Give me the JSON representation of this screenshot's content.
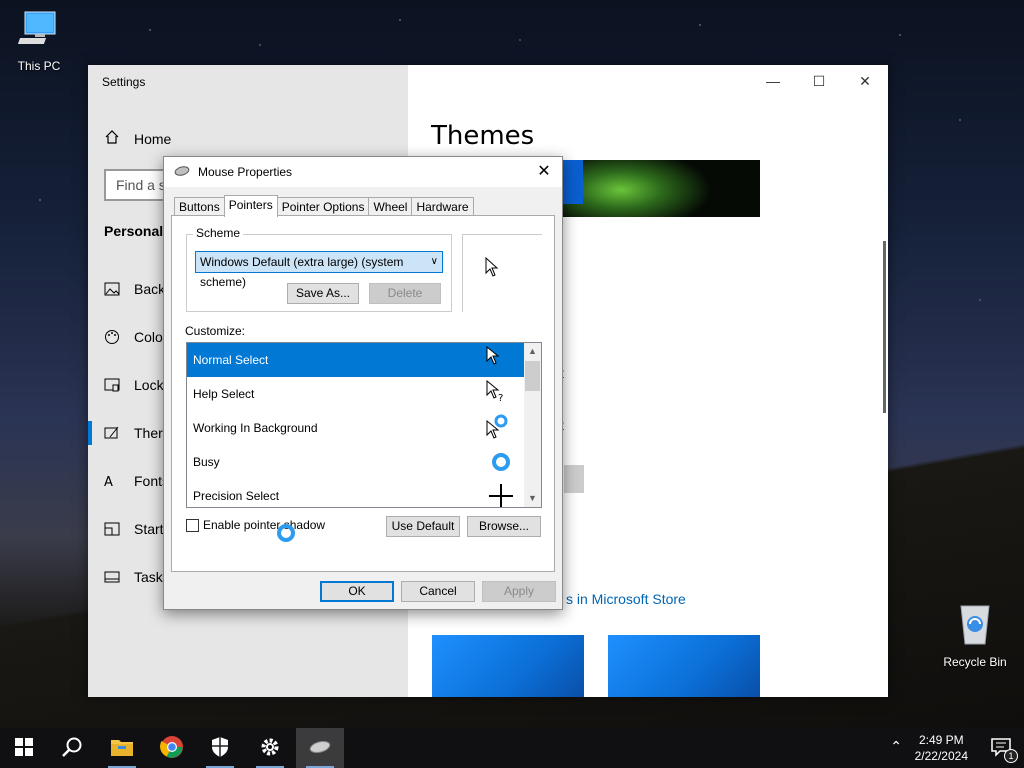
{
  "desktop": {
    "icons": [
      {
        "label": "This PC",
        "icon": "this-pc-icon"
      },
      {
        "label": "Recycle Bin",
        "icon": "recycle-bin-icon"
      }
    ]
  },
  "settings": {
    "window_title": "Settings",
    "sidebar": {
      "home_label": "Home",
      "find_placeholder": "Find a s",
      "section_title": "Personaliz",
      "items": [
        {
          "label": "Back",
          "icon": "picture-icon"
        },
        {
          "label": "Colo",
          "icon": "palette-icon"
        },
        {
          "label": "Lock",
          "icon": "lock-screen-icon"
        },
        {
          "label": "Ther",
          "icon": "themes-icon"
        },
        {
          "label": "Fonts",
          "icon": "fonts-icon"
        },
        {
          "label": "Start",
          "icon": "start-icon"
        },
        {
          "label": "Taskb",
          "icon": "taskbar-icon"
        }
      ]
    },
    "main": {
      "title": "Themes",
      "fragments": [
        "t",
        "t"
      ],
      "store_link": "s in Microsoft Store"
    }
  },
  "dialog": {
    "title": "Mouse Properties",
    "tabs": [
      "Buttons",
      "Pointers",
      "Pointer Options",
      "Wheel",
      "Hardware"
    ],
    "active_tab": "Pointers",
    "scheme": {
      "group_label": "Scheme",
      "selected": "Windows Default (extra large) (system scheme)",
      "save_as": "Save As...",
      "delete": "Delete"
    },
    "customize_label": "Customize:",
    "pointers": [
      {
        "name": "Normal Select",
        "selected": true,
        "cursor": "arrow-cursor-icon"
      },
      {
        "name": "Help Select",
        "selected": false,
        "cursor": "help-cursor-icon"
      },
      {
        "name": "Working In Background",
        "selected": false,
        "cursor": "working-cursor-icon"
      },
      {
        "name": "Busy",
        "selected": false,
        "cursor": "busy-cursor-icon"
      },
      {
        "name": "Precision Select",
        "selected": false,
        "cursor": "crosshair-cursor-icon"
      }
    ],
    "enable_shadow_label": "Enable pointer shadow",
    "use_default": "Use Default",
    "browse": "Browse...",
    "ok": "OK",
    "cancel": "Cancel",
    "apply": "Apply"
  },
  "taskbar": {
    "time": "2:49 PM",
    "date": "2/22/2024",
    "notification_count": "1",
    "accent": "#0078d4"
  }
}
